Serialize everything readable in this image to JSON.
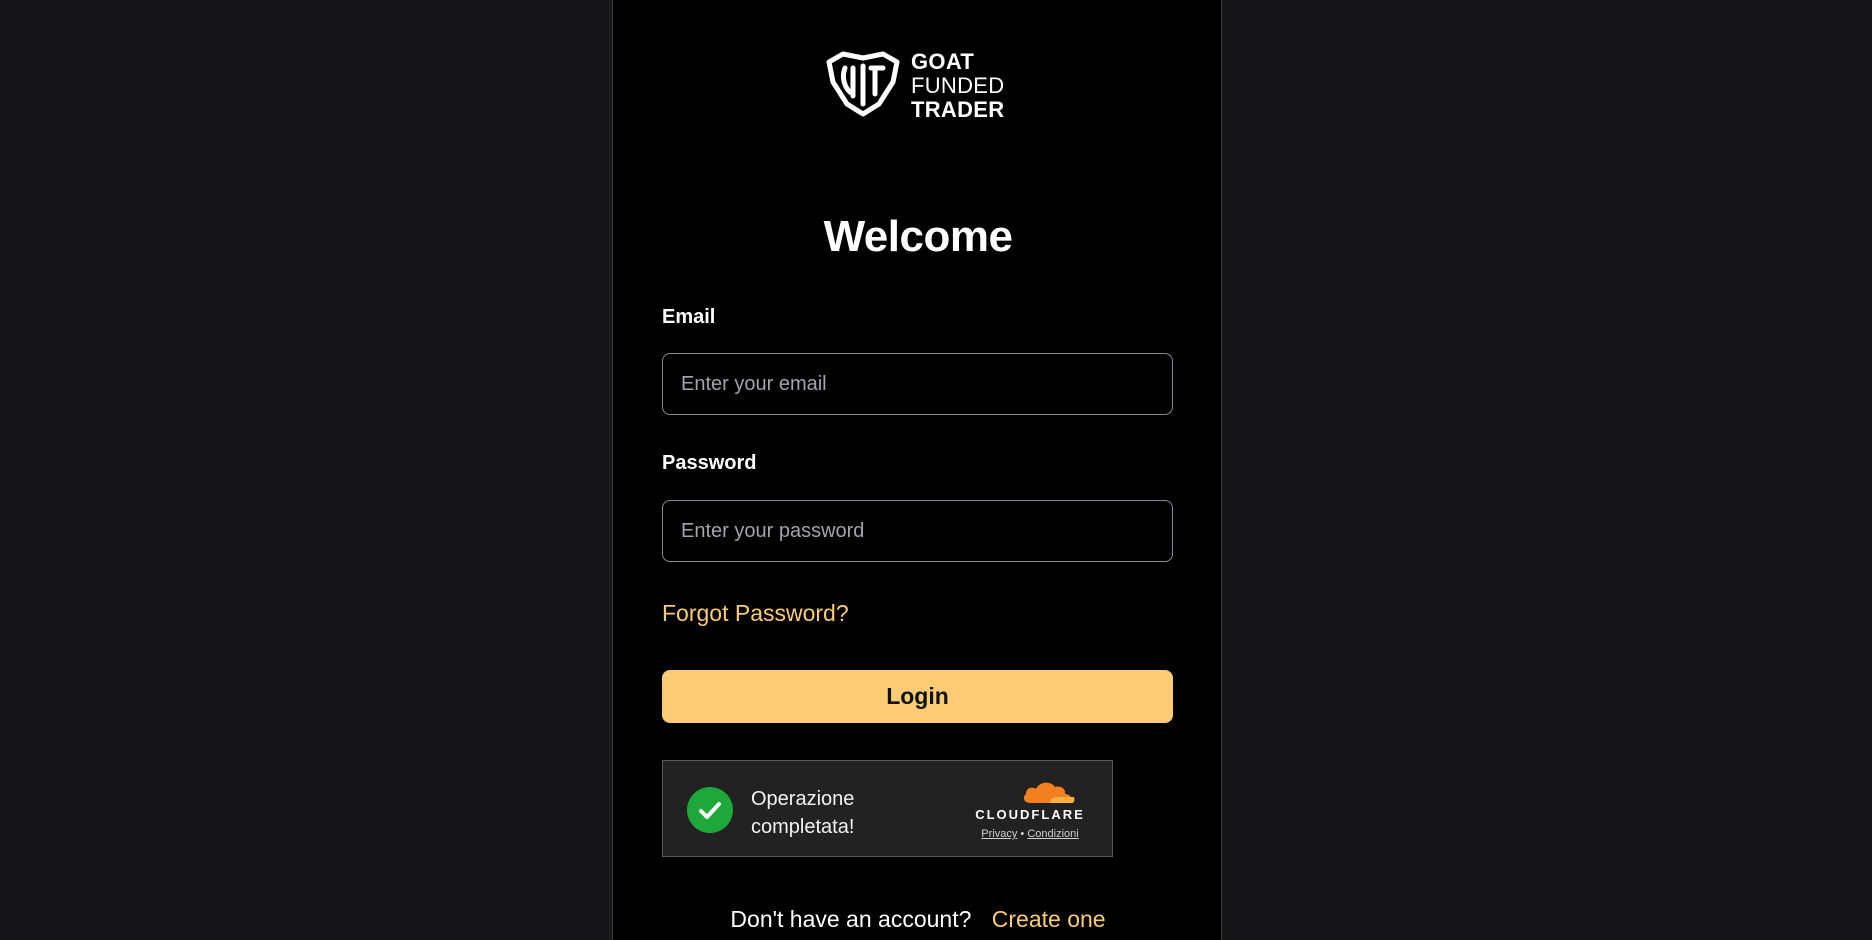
{
  "brand": {
    "line1": "GOAT",
    "line2": "FUNDED",
    "line3": "TRADER",
    "logo_icon": "goat-shield-icon"
  },
  "title": "Welcome",
  "email": {
    "label": "Email",
    "placeholder": "Enter your email",
    "value": ""
  },
  "password": {
    "label": "Password",
    "placeholder": "Enter your password",
    "value": ""
  },
  "forgot_link": "Forgot Password?",
  "login_button": "Login",
  "captcha": {
    "status_line1": "Operazione",
    "status_line2": "completata!",
    "provider": "CLOUDFLARE",
    "privacy_link": "Privacy",
    "separator": "•",
    "terms_link": "Condizioni",
    "check_icon": "check-icon",
    "cloud_icon": "cloudflare-cloud-icon"
  },
  "signup": {
    "question": "Don't have an account?",
    "link": "Create one"
  },
  "colors": {
    "page_bg": "#15151a",
    "panel_bg": "#000000",
    "accent": "#fccc75",
    "check_green": "#1fa83a",
    "cloud_orange": "#f38020"
  }
}
